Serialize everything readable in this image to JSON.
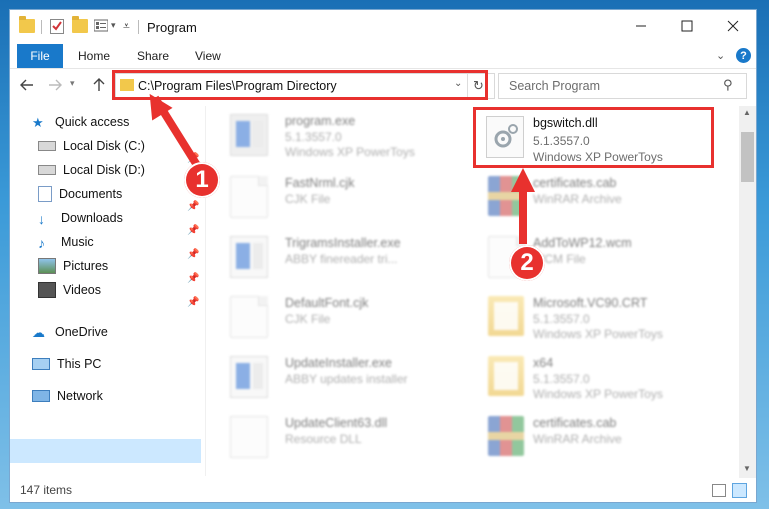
{
  "window": {
    "title": "Program"
  },
  "ribbon": {
    "tabs": [
      "File",
      "Home",
      "Share",
      "View"
    ]
  },
  "address": {
    "path": "C:\\Program Files\\Program Directory"
  },
  "search": {
    "placeholder": "Search Program"
  },
  "sidebar": {
    "quick_access": "Quick access",
    "items": [
      "Local Disk (C:)",
      "Local Disk (D:)",
      "Documents",
      "Downloads",
      "Music",
      "Pictures",
      "Videos"
    ],
    "onedrive": "OneDrive",
    "this_pc": "This PC",
    "network": "Network"
  },
  "files": [
    {
      "name": "program.exe",
      "line1": "5.1.3557.0",
      "line2": "Windows XP PowerToys",
      "icon": "exe-icon"
    },
    {
      "name": "bgswitch.dll",
      "line1": "5.1.3557.0",
      "line2": "Windows XP PowerToys",
      "icon": "dll-icon"
    },
    {
      "name": "FastNrml.cjk",
      "line1": "CJK File",
      "line2": "",
      "icon": "document-icon"
    },
    {
      "name": "certificates.cab",
      "line1": "WinRAR Archive",
      "line2": "",
      "icon": "winrar-icon"
    },
    {
      "name": "TrigramsInstaller.exe",
      "line1": "ABBY finereader tri...",
      "line2": "",
      "icon": "installer-icon"
    },
    {
      "name": "AddToWP12.wcm",
      "line1": "WCM File",
      "line2": "",
      "icon": "document-icon"
    },
    {
      "name": "DefaultFont.cjk",
      "line1": "CJK File",
      "line2": "",
      "icon": "document-icon"
    },
    {
      "name": "Microsoft.VC90.CRT",
      "line1": "5.1.3557.0",
      "line2": "Windows XP PowerToys",
      "icon": "folder-icon"
    },
    {
      "name": "UpdateInstaller.exe",
      "line1": "ABBY updates installer",
      "line2": "",
      "icon": "installer-icon"
    },
    {
      "name": "x64",
      "line1": "5.1.3557.0",
      "line2": "Windows XP PowerToys",
      "icon": "folder-icon"
    },
    {
      "name": "UpdateClient63.dll",
      "line1": "Resource DLL",
      "line2": "",
      "icon": "dll-icon"
    },
    {
      "name": "certificates.cab",
      "line1": "WinRAR Archive",
      "line2": "",
      "icon": "winrar-icon"
    }
  ],
  "status": {
    "count": "147 items"
  },
  "callouts": {
    "one": "1",
    "two": "2"
  },
  "colors": {
    "accent": "#1979ca",
    "highlight": "#e8312e",
    "selection": "#cce8ff"
  }
}
